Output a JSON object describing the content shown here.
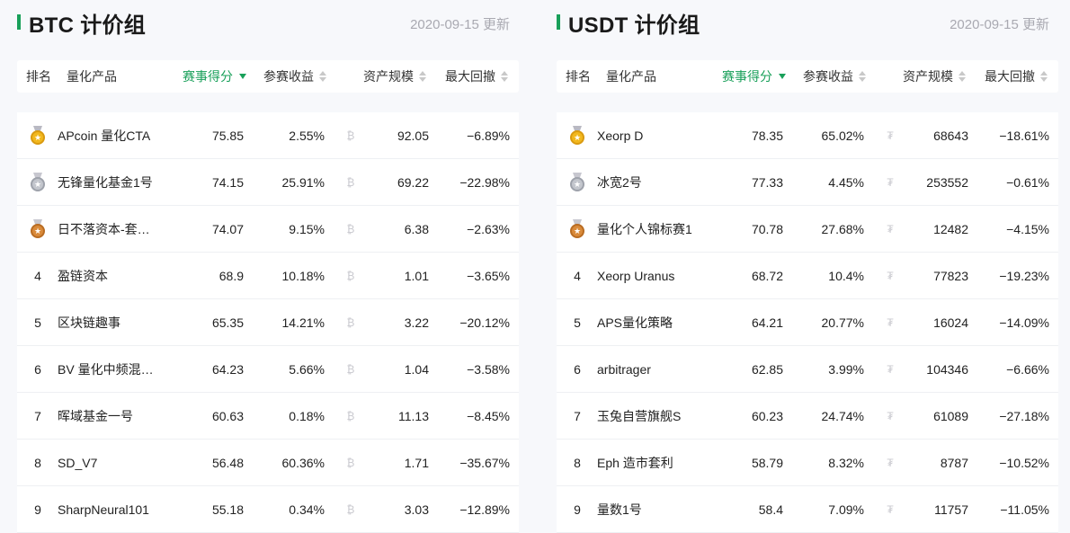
{
  "panels": [
    {
      "title": "BTC 计价组",
      "updated": "2020-09-15 更新",
      "coin_symbol": "₿",
      "headers": {
        "rank": "排名",
        "name": "量化产品",
        "score": "赛事得分",
        "return": "参赛收益",
        "aum": "资产规模",
        "drawdown": "最大回撤"
      },
      "rows": [
        {
          "rank": "1",
          "medal": "gold",
          "name": "APcoin 量化CTA",
          "score": "75.85",
          "return": "2.55%",
          "aum": "92.05",
          "drawdown": "−6.89%"
        },
        {
          "rank": "2",
          "medal": "silver",
          "name": "无锋量化基金1号",
          "score": "74.15",
          "return": "25.91%",
          "aum": "69.22",
          "drawdown": "−22.98%"
        },
        {
          "rank": "3",
          "medal": "bronze",
          "name": "日不落资本-套…",
          "score": "74.07",
          "return": "9.15%",
          "aum": "6.38",
          "drawdown": "−2.63%"
        },
        {
          "rank": "4",
          "medal": "",
          "name": "盈链资本",
          "score": "68.9",
          "return": "10.18%",
          "aum": "1.01",
          "drawdown": "−3.65%"
        },
        {
          "rank": "5",
          "medal": "",
          "name": "区块链趣事",
          "score": "65.35",
          "return": "14.21%",
          "aum": "3.22",
          "drawdown": "−20.12%"
        },
        {
          "rank": "6",
          "medal": "",
          "name": "BV 量化中频混…",
          "score": "64.23",
          "return": "5.66%",
          "aum": "1.04",
          "drawdown": "−3.58%"
        },
        {
          "rank": "7",
          "medal": "",
          "name": "晖域基金一号",
          "score": "60.63",
          "return": "0.18%",
          "aum": "11.13",
          "drawdown": "−8.45%"
        },
        {
          "rank": "8",
          "medal": "",
          "name": "SD_V7",
          "score": "56.48",
          "return": "60.36%",
          "aum": "1.71",
          "drawdown": "−35.67%"
        },
        {
          "rank": "9",
          "medal": "",
          "name": "SharpNeural101",
          "score": "55.18",
          "return": "0.34%",
          "aum": "3.03",
          "drawdown": "−12.89%"
        }
      ]
    },
    {
      "title": "USDT 计价组",
      "updated": "2020-09-15 更新",
      "coin_symbol": "₮",
      "headers": {
        "rank": "排名",
        "name": "量化产品",
        "score": "赛事得分",
        "return": "参赛收益",
        "aum": "资产规模",
        "drawdown": "最大回撤"
      },
      "rows": [
        {
          "rank": "1",
          "medal": "gold",
          "name": "Xeorp D",
          "score": "78.35",
          "return": "65.02%",
          "aum": "68643",
          "drawdown": "−18.61%"
        },
        {
          "rank": "2",
          "medal": "silver",
          "name": "冰宽2号",
          "score": "77.33",
          "return": "4.45%",
          "aum": "253552",
          "drawdown": "−0.61%"
        },
        {
          "rank": "3",
          "medal": "bronze",
          "name": "量化个人锦标赛1",
          "score": "70.78",
          "return": "27.68%",
          "aum": "12482",
          "drawdown": "−4.15%"
        },
        {
          "rank": "4",
          "medal": "",
          "name": "Xeorp Uranus",
          "score": "68.72",
          "return": "10.4%",
          "aum": "77823",
          "drawdown": "−19.23%"
        },
        {
          "rank": "5",
          "medal": "",
          "name": "APS量化策略",
          "score": "64.21",
          "return": "20.77%",
          "aum": "16024",
          "drawdown": "−14.09%"
        },
        {
          "rank": "6",
          "medal": "",
          "name": "arbitrager",
          "score": "62.85",
          "return": "3.99%",
          "aum": "104346",
          "drawdown": "−6.66%"
        },
        {
          "rank": "7",
          "medal": "",
          "name": "玉兔自营旗舰S",
          "score": "60.23",
          "return": "24.74%",
          "aum": "61089",
          "drawdown": "−27.18%"
        },
        {
          "rank": "8",
          "medal": "",
          "name": "Eph 造市套利",
          "score": "58.79",
          "return": "8.32%",
          "aum": "8787",
          "drawdown": "−10.52%"
        },
        {
          "rank": "9",
          "medal": "",
          "name": "量数1号",
          "score": "58.4",
          "return": "7.09%",
          "aum": "11757",
          "drawdown": "−11.05%"
        }
      ]
    }
  ],
  "colors": {
    "accent": "#19a05a",
    "muted": "#a9a9b1",
    "gold": "#f2b81e",
    "silver": "#c3c6cd",
    "bronze": "#d98a3a"
  },
  "icons": {
    "medal_gold": "gold-medal-icon",
    "medal_silver": "silver-medal-icon",
    "medal_bronze": "bronze-medal-icon",
    "sort_active": "sort-desc-icon",
    "sort": "sort-icon"
  }
}
